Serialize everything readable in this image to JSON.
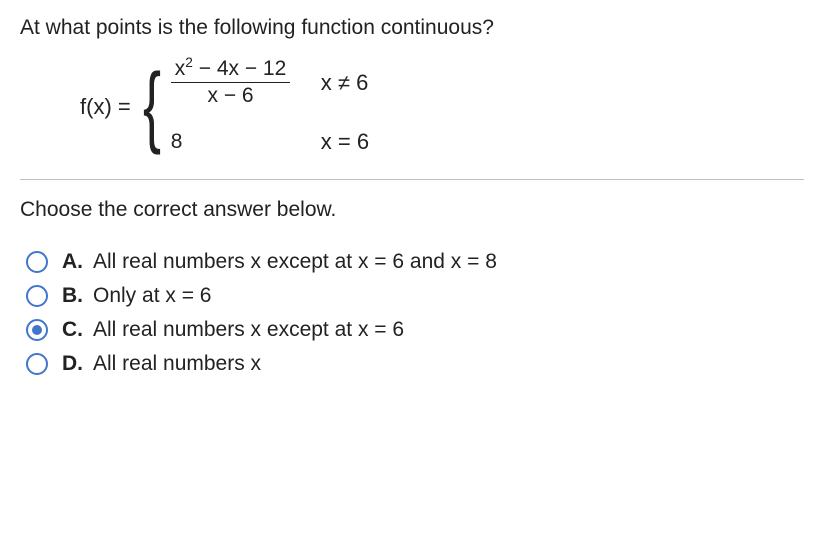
{
  "question": "At what points is the following function continuous?",
  "function": {
    "lhs": "f(x) =",
    "piece1": {
      "numerator_html": "x<sup>2</sup> − 4x − 12",
      "denominator": "x − 6",
      "condition": "x ≠ 6"
    },
    "piece2": {
      "value": "8",
      "condition": "x = 6"
    }
  },
  "instruction": "Choose the correct answer below.",
  "options": [
    {
      "letter": "A.",
      "text": "All real numbers x except at x = 6 and x = 8",
      "selected": false
    },
    {
      "letter": "B.",
      "text": "Only at x = 6",
      "selected": false
    },
    {
      "letter": "C.",
      "text": "All real numbers x except at x = 6",
      "selected": true
    },
    {
      "letter": "D.",
      "text": "All real numbers x",
      "selected": false
    }
  ]
}
